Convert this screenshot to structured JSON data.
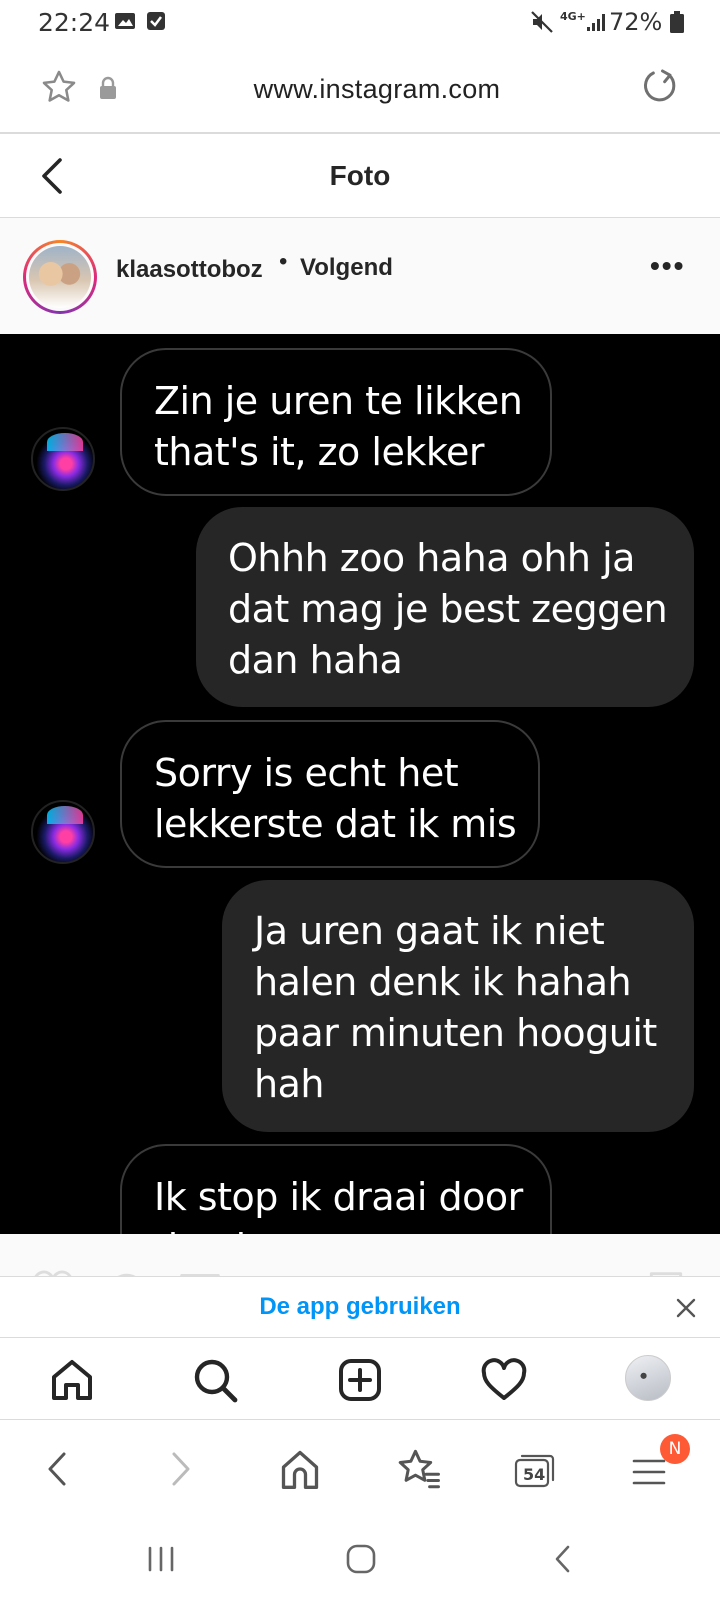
{
  "status_bar": {
    "time": "22:24",
    "left_icons": [
      "image-icon",
      "checkbox-icon"
    ],
    "right_icons": [
      "mute-icon",
      "4g-icon",
      "signal-icon",
      "battery-icon"
    ],
    "network": "4G+",
    "battery": "72%"
  },
  "browser": {
    "url": "www.instagram.com",
    "tab_count": "54",
    "menu_badge": "N"
  },
  "header": {
    "title": "Foto"
  },
  "post": {
    "username": "klaasottoboz",
    "separator": "•",
    "follow_status": "Volgend",
    "more": "•••"
  },
  "chat": {
    "messages": [
      {
        "side": "in",
        "text": "Zin je uren te likken\nthat's it, zo lekker"
      },
      {
        "side": "out",
        "text": "Ohhh zoo haha ohh ja\ndat mag je best zeggen\ndan haha"
      },
      {
        "side": "in",
        "text": "Sorry is echt het\nlekkerste dat ik mis"
      },
      {
        "side": "out",
        "text": "Ja uren gaat ik niet\nhalen denk ik hahah\npaar minuten hooguit\nhah"
      },
      {
        "side": "in",
        "text": "Ik stop ik draai door\ndan ja"
      }
    ]
  },
  "banner": {
    "label": "De app gebruiken"
  },
  "colors": {
    "accent": "#0095f6",
    "bubble_out": "#262626",
    "photo_bg": "#000000",
    "badge": "#ff5a36"
  }
}
